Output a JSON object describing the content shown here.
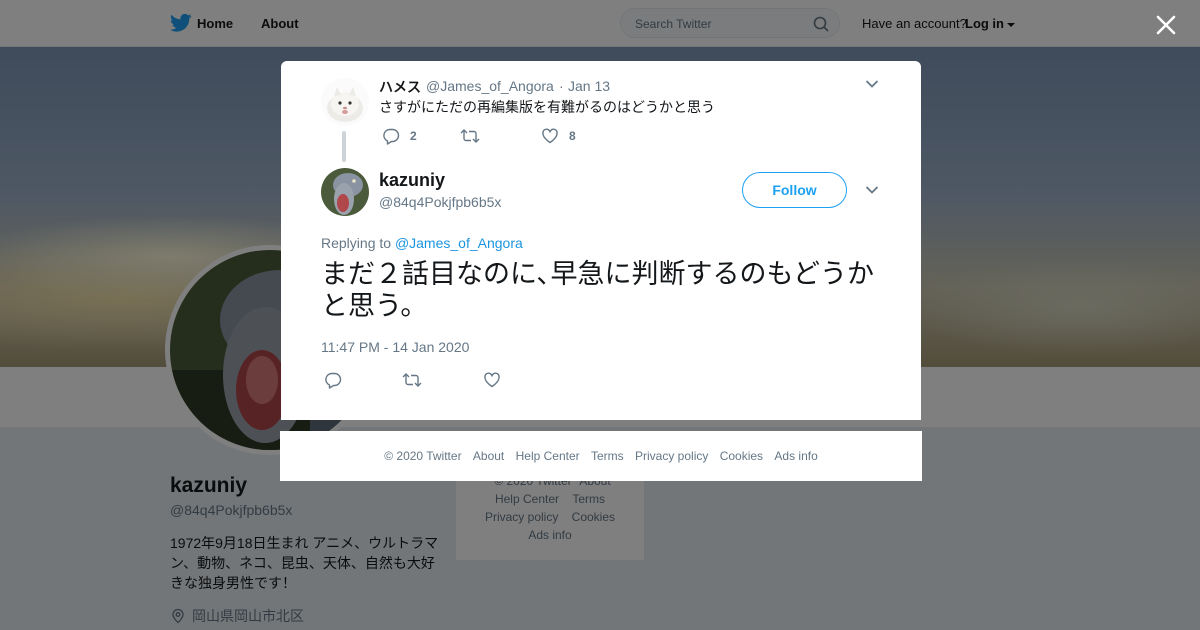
{
  "nav": {
    "home_label": "Home",
    "about_label": "About",
    "search_placeholder": "Search Twitter",
    "account_prompt": "Have an account?",
    "login_label": "Log in"
  },
  "profile": {
    "name": "kazuniy",
    "handle": "@84q4Pokjfpb6b5x",
    "bio": "1972年9月18日生まれ アニメ、ウルトラマン、動物、ネコ、昆虫、天体、自然も大好きな独身男性です！",
    "location": "岡山県岡山市北区"
  },
  "side_footer": {
    "copyright": "© 2020 Twitter",
    "about": "About",
    "help": "Help Center",
    "terms": "Terms",
    "privacy": "Privacy policy",
    "cookies": "Cookies",
    "ads": "Ads info"
  },
  "context_tweet": {
    "name": "ハメス",
    "handle": "@James_of_Angora",
    "separator": "·",
    "date": "Jan 13",
    "text": "さすがにただの再編集版を有難がるのはどうかと思う",
    "reply_count": "2",
    "like_count": "8"
  },
  "main_tweet": {
    "name": "kazuniy",
    "handle": "@84q4Pokjfpb6b5x",
    "follow_label": "Follow",
    "replying_prefix": "Replying to",
    "replying_to": "@James_of_Angora",
    "text": "まだ２話目なのに､早急に判断するのもどうかと思う。",
    "timestamp": "11:47 PM - 14 Jan 2020"
  },
  "modal_footer": {
    "copyright": "© 2020 Twitter",
    "about": "About",
    "help": "Help Center",
    "terms": "Terms",
    "privacy": "Privacy policy",
    "cookies": "Cookies",
    "ads": "Ads info"
  },
  "colors": {
    "twitter_blue": "#1da1f2",
    "link_blue": "#1b95e0",
    "muted_text": "#657786",
    "overlay": "rgba(0,0,0,0.5)"
  },
  "icons": [
    "twitter-bird-icon",
    "search-icon",
    "close-icon",
    "chevron-down-icon",
    "reply-icon",
    "retweet-icon",
    "like-icon",
    "location-pin-icon"
  ]
}
